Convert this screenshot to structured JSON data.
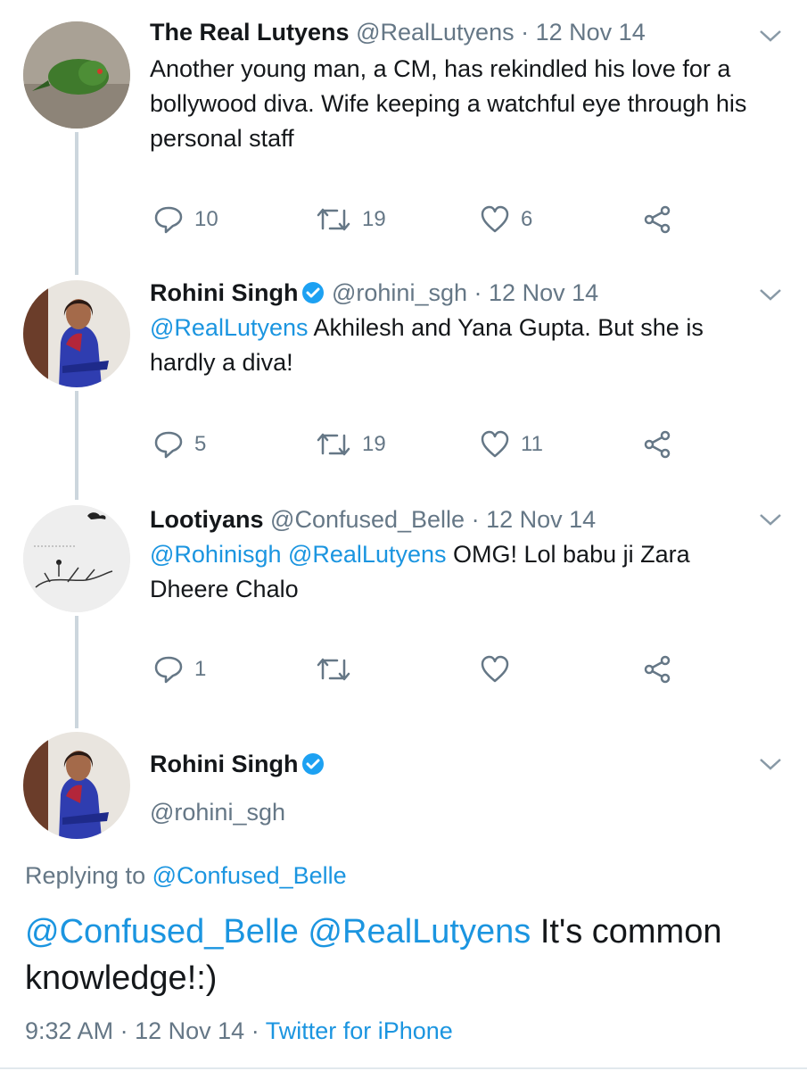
{
  "colors": {
    "link": "#1b95e0",
    "muted": "#657786",
    "text": "#14171a",
    "line": "#ccd6dd"
  },
  "tweets": [
    {
      "name": "The Real Lutyens",
      "handle": "@RealLutyens",
      "sep": "·",
      "date": "12 Nov 14",
      "mentions": "",
      "text": "Another young man, a CM, has rekindled his love for a bollywood diva. Wife keeping a watchful eye through his personal staff",
      "replies": "10",
      "retweets": "19",
      "likes": "6",
      "verified": false,
      "avatar_icon": "parrot-avatar"
    },
    {
      "name": "Rohini Singh",
      "handle": "@rohini_sgh",
      "sep": "·",
      "date": "12 Nov 14",
      "mentions": "@RealLutyens",
      "text": "Akhilesh and Yana Gupta. But she is hardly a diva!",
      "replies": "5",
      "retweets": "19",
      "likes": "11",
      "verified": true,
      "avatar_icon": "woman-in-saree-avatar"
    },
    {
      "name": "Lootiyans",
      "handle": "@Confused_Belle",
      "sep": "·",
      "date": "12 Nov 14",
      "mentions": "@Rohinisgh @RealLutyens",
      "text": "OMG! Lol babu ji Zara Dheere Chalo",
      "replies": "1",
      "retweets": "",
      "likes": "",
      "verified": false,
      "avatar_icon": "sketch-avatar"
    }
  ],
  "main": {
    "name": "Rohini Singh",
    "handle": "@rohini_sgh",
    "replying_prefix": "Replying to",
    "replying_to": "@Confused_Belle",
    "mentions": "@Confused_Belle @RealLutyens",
    "text": "It's common knowledge!:)",
    "time": "9:32 AM",
    "sep1": "·",
    "date": "12 Nov 14",
    "sep2": "·",
    "source": "Twitter for iPhone"
  }
}
